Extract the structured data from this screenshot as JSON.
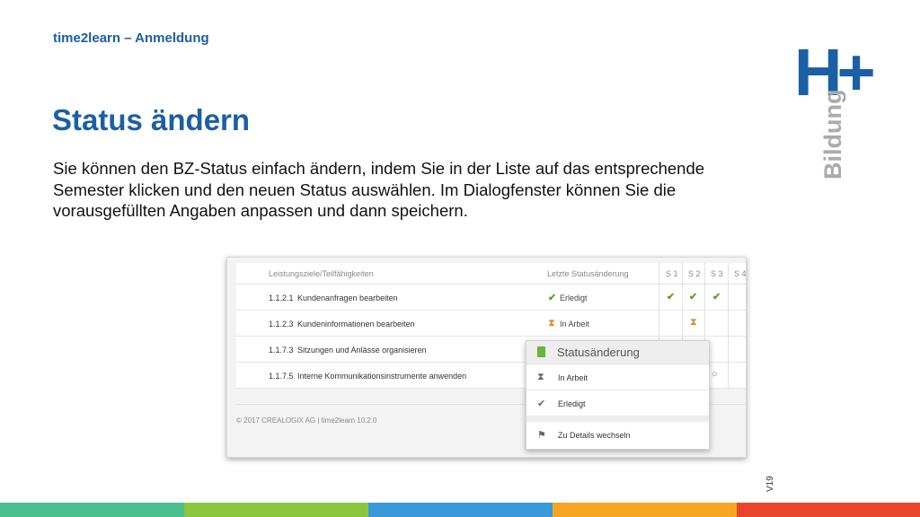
{
  "header": {
    "kicker": "time2learn – Anmeldung"
  },
  "title": "Status ändern",
  "body": "Sie können den BZ-Status einfach ändern, indem Sie in der Liste auf das entsprechende Semester klicken und den neuen Status auswählen. Im Dialogfenster können Sie die vorausgefüllten Angaben anpassen und dann speichern.",
  "logo": {
    "mark": "H+",
    "sub": "Bildung"
  },
  "screenshot": {
    "columns": [
      "Leistungsziele/Teilfähigkeiten",
      "Letzte Statusänderung",
      "S 1",
      "S 2",
      "S 3",
      "S 4"
    ],
    "rows": [
      {
        "code": "1.1.2.1",
        "name": "Kundenanfragen bearbeiten",
        "status": "Erledigt",
        "status_icon": "check-icon"
      },
      {
        "code": "1.1.2.3",
        "name": "Kundeninformationen bearbeiten",
        "status": "In Arbeit",
        "status_icon": "hourglass-icon"
      },
      {
        "code": "1.1.7.3",
        "name": "Sitzungen und Anlässe organisieren",
        "status": "",
        "status_icon": ""
      },
      {
        "code": "1.1.7.5",
        "name": "Interne Kommunikationsinstrumente anwenden",
        "status": "",
        "status_icon": ""
      }
    ],
    "footer": "© 2017 CREALOGIX AG | time2learn 10.2.0",
    "popup": {
      "title": "Statusänderung",
      "items": [
        {
          "label": "In Arbeit",
          "icon": "hourglass-icon"
        },
        {
          "label": "Erledigt",
          "icon": "check-icon"
        },
        {
          "label": "Zu Details wechseln",
          "icon": "flag-icon"
        }
      ]
    }
  },
  "version": "V19",
  "colors": {
    "brand_blue": "#1b5fa5",
    "stripes": [
      "#4bbf8e",
      "#8cc63f",
      "#3a9ad9",
      "#f6a623",
      "#e8452c"
    ]
  }
}
